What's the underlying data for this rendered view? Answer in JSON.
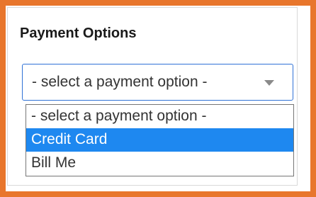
{
  "window": {
    "accent_color": "#e8762c"
  },
  "payment": {
    "title": "Payment Options",
    "select": {
      "value": "- select a payment option -",
      "focus_color": "#2f72d6"
    },
    "options": [
      {
        "label": "- select a payment option -",
        "highlighted": false
      },
      {
        "label": "Credit Card",
        "highlighted": true
      },
      {
        "label": "Bill Me",
        "highlighted": false
      }
    ],
    "highlight_color": "#1e88f0"
  },
  "icons": {
    "dropdown": "chevron-down-icon"
  }
}
